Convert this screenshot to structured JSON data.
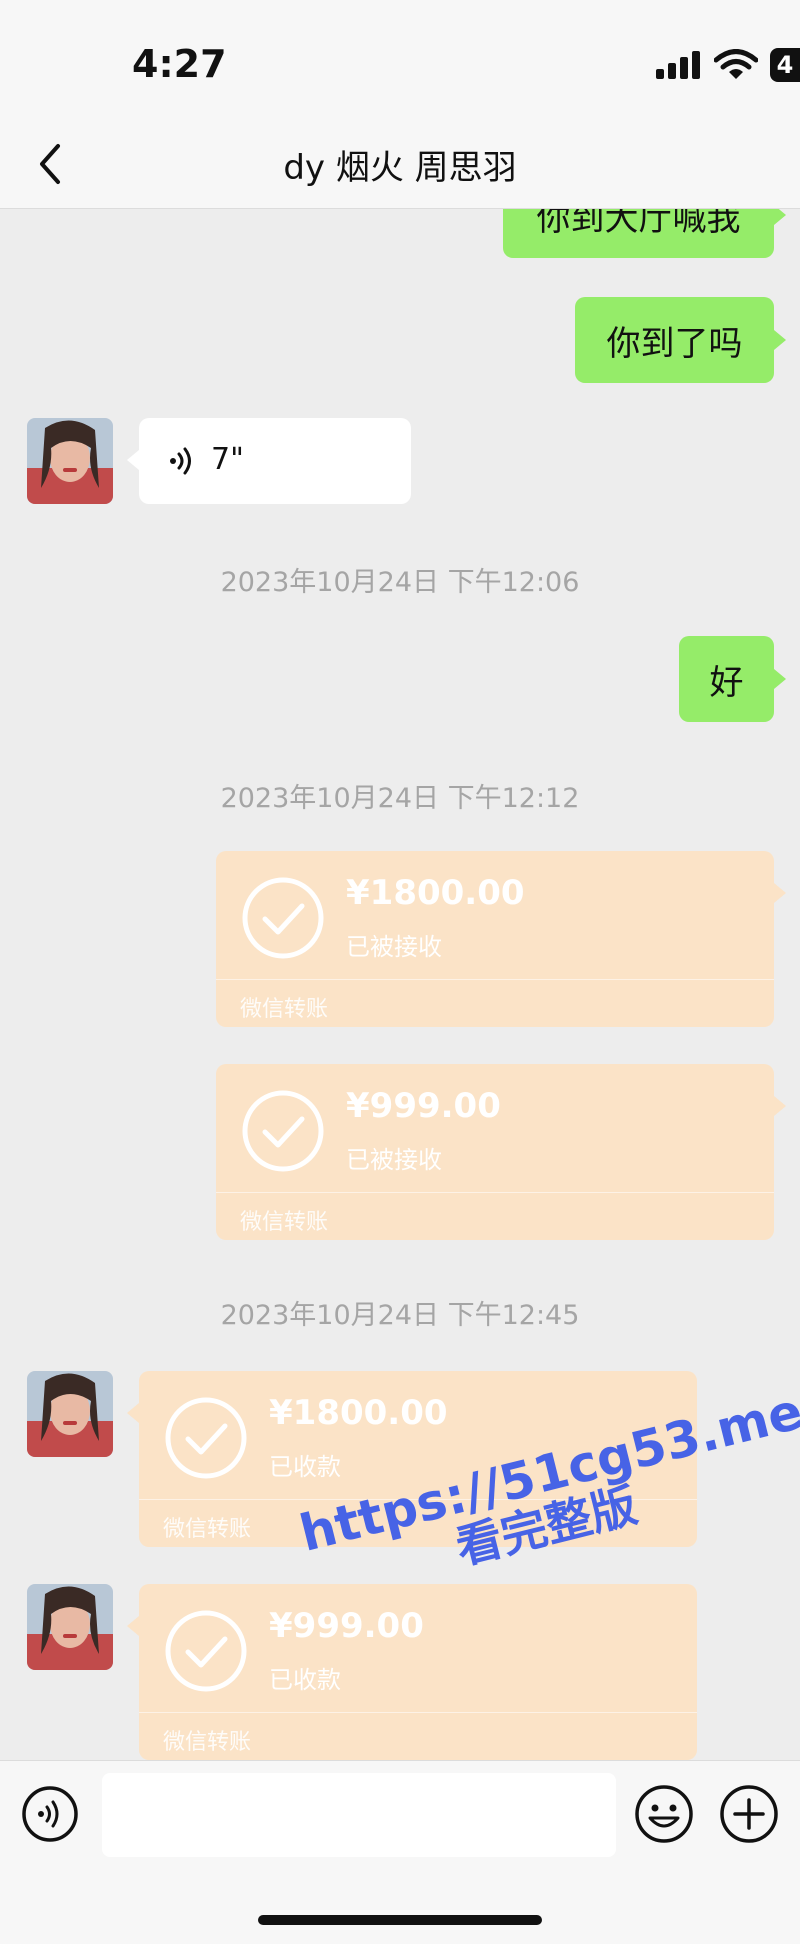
{
  "status_bar": {
    "time": "4:27",
    "battery": "4"
  },
  "header": {
    "title": "dy 烟火 周思羽"
  },
  "messages": {
    "m1_text": "你到大厅喊我",
    "m2_text": "你到了吗",
    "voice_duration": "7\"",
    "timestamp1": "2023年10月24日 下午12:06",
    "m4_text": "好",
    "timestamp2": "2023年10月24日 下午12:12",
    "t1": {
      "amount": "¥1800.00",
      "status": "已被接收",
      "footer": "微信转账"
    },
    "t2": {
      "amount": "¥999.00",
      "status": "已被接收",
      "footer": "微信转账"
    },
    "timestamp3": "2023年10月24日 下午12:45",
    "t3": {
      "amount": "¥1800.00",
      "status": "已收款",
      "footer": "微信转账"
    },
    "t4": {
      "amount": "¥999.00",
      "status": "已收款",
      "footer": "微信转账"
    }
  },
  "input_bar": {
    "placeholder": ""
  },
  "watermark": {
    "line1": "https://51cg53.me",
    "line2": "看完整版"
  },
  "colors": {
    "sent_bubble": "#95ec69",
    "transfer_card": "#fbe3c7",
    "watermark": "#4763e6"
  }
}
